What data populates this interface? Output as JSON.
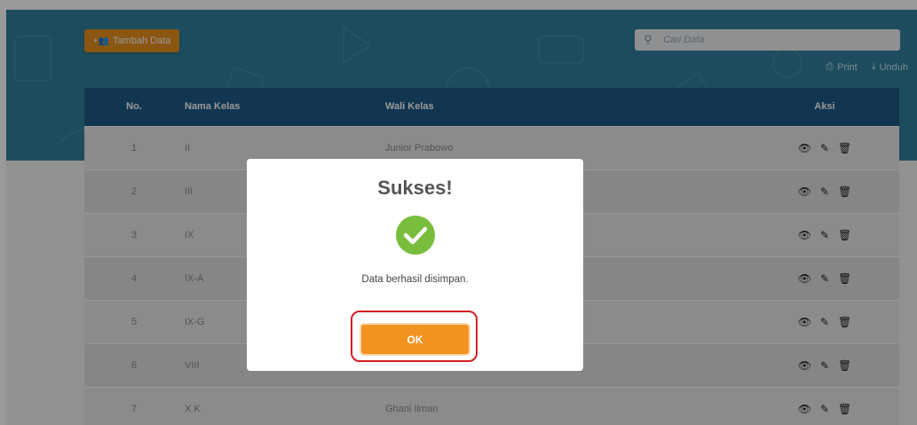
{
  "toolbar": {
    "add_label": "Tambah Data",
    "search_placeholder": "Cari Data",
    "print_label": "Print",
    "download_label": "Unduh"
  },
  "table": {
    "headers": [
      "No.",
      "Nama Kelas",
      "Wali Kelas",
      "Aksi"
    ],
    "rows": [
      {
        "no": "1",
        "kelas": "II",
        "wali": "Junior Prabowo"
      },
      {
        "no": "2",
        "kelas": "III",
        "wali": ""
      },
      {
        "no": "3",
        "kelas": "IX",
        "wali": ""
      },
      {
        "no": "4",
        "kelas": "IX-A",
        "wali": ""
      },
      {
        "no": "5",
        "kelas": "IX-G",
        "wali": ""
      },
      {
        "no": "6",
        "kelas": "VIII",
        "wali": ""
      },
      {
        "no": "7",
        "kelas": "X K",
        "wali": "Ghani Ilman"
      }
    ]
  },
  "modal": {
    "title": "Sukses!",
    "message": "Data berhasil disimpan.",
    "ok_label": "OK"
  },
  "colors": {
    "banner": "#2f7f9c",
    "header": "#1f5a86",
    "accent": "#f29320",
    "success": "#78be3c",
    "highlight": "#d41e24"
  }
}
